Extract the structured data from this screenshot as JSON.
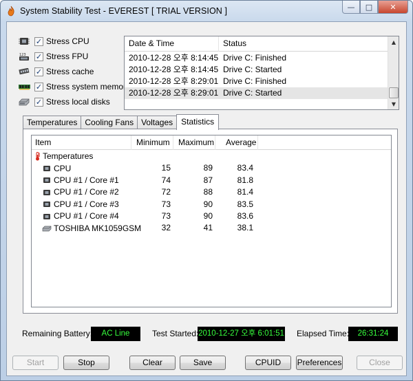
{
  "window": {
    "title": "System Stability Test - EVEREST  [ TRIAL VERSION ]",
    "min_glyph": "—",
    "max_glyph": "□",
    "close_glyph": "✕"
  },
  "stress": [
    {
      "label": "Stress CPU",
      "checked": true,
      "icon": "cpu-chip-icon"
    },
    {
      "label": "Stress FPU",
      "checked": true,
      "icon": "fpu-icon"
    },
    {
      "label": "Stress cache",
      "checked": true,
      "icon": "memory-module-icon"
    },
    {
      "label": "Stress system memory",
      "checked": true,
      "icon": "ram-stick-icon"
    },
    {
      "label": "Stress local disks",
      "checked": true,
      "icon": "hard-disk-icon"
    }
  ],
  "checkmark": "✓",
  "log": {
    "headers": {
      "date": "Date & Time",
      "status": "Status"
    },
    "rows": [
      {
        "date": "2010-12-28 오후 8:14:45",
        "status": "Drive C: Finished"
      },
      {
        "date": "2010-12-28 오후 8:14:45",
        "status": "Drive C: Started"
      },
      {
        "date": "2010-12-28 오후 8:29:01",
        "status": "Drive C: Finished"
      },
      {
        "date": "2010-12-28 오후 8:29:01",
        "status": "Drive C: Started"
      }
    ]
  },
  "tabs": [
    "Temperatures",
    "Cooling Fans",
    "Voltages",
    "Statistics"
  ],
  "stats": {
    "headers": {
      "item": "Item",
      "min": "Minimum",
      "max": "Maximum",
      "avg": "Average"
    },
    "group": "Temperatures",
    "rows": [
      {
        "item": "CPU",
        "min": "15",
        "max": "89",
        "avg": "83.4"
      },
      {
        "item": "CPU #1 / Core #1",
        "min": "74",
        "max": "87",
        "avg": "81.8"
      },
      {
        "item": "CPU #1 / Core #2",
        "min": "72",
        "max": "88",
        "avg": "81.4"
      },
      {
        "item": "CPU #1 / Core #3",
        "min": "73",
        "max": "90",
        "avg": "83.5"
      },
      {
        "item": "CPU #1 / Core #4",
        "min": "73",
        "max": "90",
        "avg": "83.6"
      },
      {
        "item": "TOSHIBA MK1059GSM",
        "min": "32",
        "max": "41",
        "avg": "38.1"
      }
    ]
  },
  "status": {
    "battery_label": "Remaining Battery:",
    "battery_value": "AC Line",
    "started_label": "Test Started:",
    "started_value": "2010-12-27 오후 6:01:51",
    "elapsed_label": "Elapsed Time:",
    "elapsed_value": "26:31:24"
  },
  "buttons": {
    "start": "Start",
    "stop": "Stop",
    "clear": "Clear",
    "save": "Save",
    "cpuid": "CPUID",
    "preferences": "Preferences",
    "close": "Close"
  },
  "colors": {
    "lcd_bg": "#000000",
    "lcd_text": "#37ff3d",
    "thermometer": "#d62a1e"
  }
}
